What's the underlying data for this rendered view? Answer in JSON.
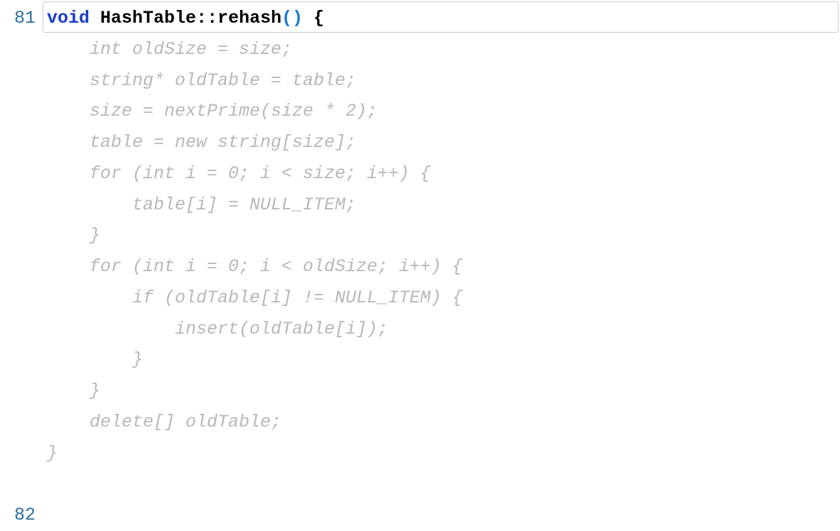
{
  "gutter": {
    "lineNumbers": [
      "81",
      "",
      "",
      "",
      "",
      "",
      "",
      "",
      "",
      "",
      "",
      "",
      "",
      "",
      "",
      "",
      "82"
    ]
  },
  "code": {
    "sig": {
      "kw": "void",
      "space1": " ",
      "cls": "HashTable",
      "scope": "::",
      "fn": "rehash",
      "lp": "(",
      "rp": ")",
      "space2": " ",
      "lb": "{"
    },
    "ghostLines": [
      "    int oldSize = size;",
      "    string* oldTable = table;",
      "    size = nextPrime(size * 2);",
      "    table = new string[size];",
      "    for (int i = 0; i < size; i++) {",
      "        table[i] = NULL_ITEM;",
      "    }",
      "    for (int i = 0; i < oldSize; i++) {",
      "        if (oldTable[i] != NULL_ITEM) {",
      "            insert(oldTable[i]);",
      "        }",
      "    }",
      "    delete[] oldTable;",
      "}"
    ]
  }
}
